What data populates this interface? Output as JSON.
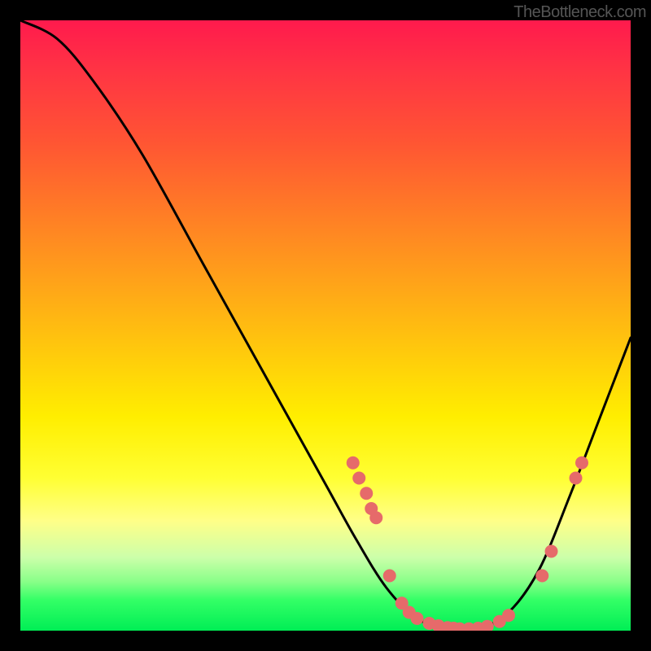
{
  "attribution": "TheBottleneck.com",
  "chart_data": {
    "type": "line",
    "title": "",
    "xlabel": "",
    "ylabel": "",
    "xlim": [
      0,
      100
    ],
    "ylim": [
      0,
      100
    ],
    "curve": [
      {
        "x": 0,
        "y": 100
      },
      {
        "x": 6,
        "y": 97
      },
      {
        "x": 12,
        "y": 90
      },
      {
        "x": 20,
        "y": 78
      },
      {
        "x": 30,
        "y": 60
      },
      {
        "x": 40,
        "y": 42
      },
      {
        "x": 50,
        "y": 24
      },
      {
        "x": 55,
        "y": 15
      },
      {
        "x": 60,
        "y": 7
      },
      {
        "x": 65,
        "y": 2
      },
      {
        "x": 70,
        "y": 0.3
      },
      {
        "x": 75,
        "y": 0.3
      },
      {
        "x": 80,
        "y": 3
      },
      {
        "x": 85,
        "y": 10
      },
      {
        "x": 90,
        "y": 22
      },
      {
        "x": 95,
        "y": 35
      },
      {
        "x": 100,
        "y": 48
      }
    ],
    "markers": [
      {
        "x": 54.5,
        "y": 27.5
      },
      {
        "x": 55.5,
        "y": 25
      },
      {
        "x": 56.7,
        "y": 22.5
      },
      {
        "x": 57.5,
        "y": 20
      },
      {
        "x": 58.3,
        "y": 18.5
      },
      {
        "x": 60.5,
        "y": 9
      },
      {
        "x": 62.5,
        "y": 4.5
      },
      {
        "x": 63.7,
        "y": 3
      },
      {
        "x": 65,
        "y": 2
      },
      {
        "x": 67,
        "y": 1.2
      },
      {
        "x": 68.5,
        "y": 0.8
      },
      {
        "x": 70,
        "y": 0.5
      },
      {
        "x": 71,
        "y": 0.4
      },
      {
        "x": 72,
        "y": 0.3
      },
      {
        "x": 73.5,
        "y": 0.3
      },
      {
        "x": 75,
        "y": 0.4
      },
      {
        "x": 76.5,
        "y": 0.7
      },
      {
        "x": 78.5,
        "y": 1.5
      },
      {
        "x": 80,
        "y": 2.5
      },
      {
        "x": 85.5,
        "y": 9
      },
      {
        "x": 87,
        "y": 13
      },
      {
        "x": 91,
        "y": 25
      },
      {
        "x": 92,
        "y": 27.5
      }
    ],
    "marker_color": "#e66a6a"
  }
}
